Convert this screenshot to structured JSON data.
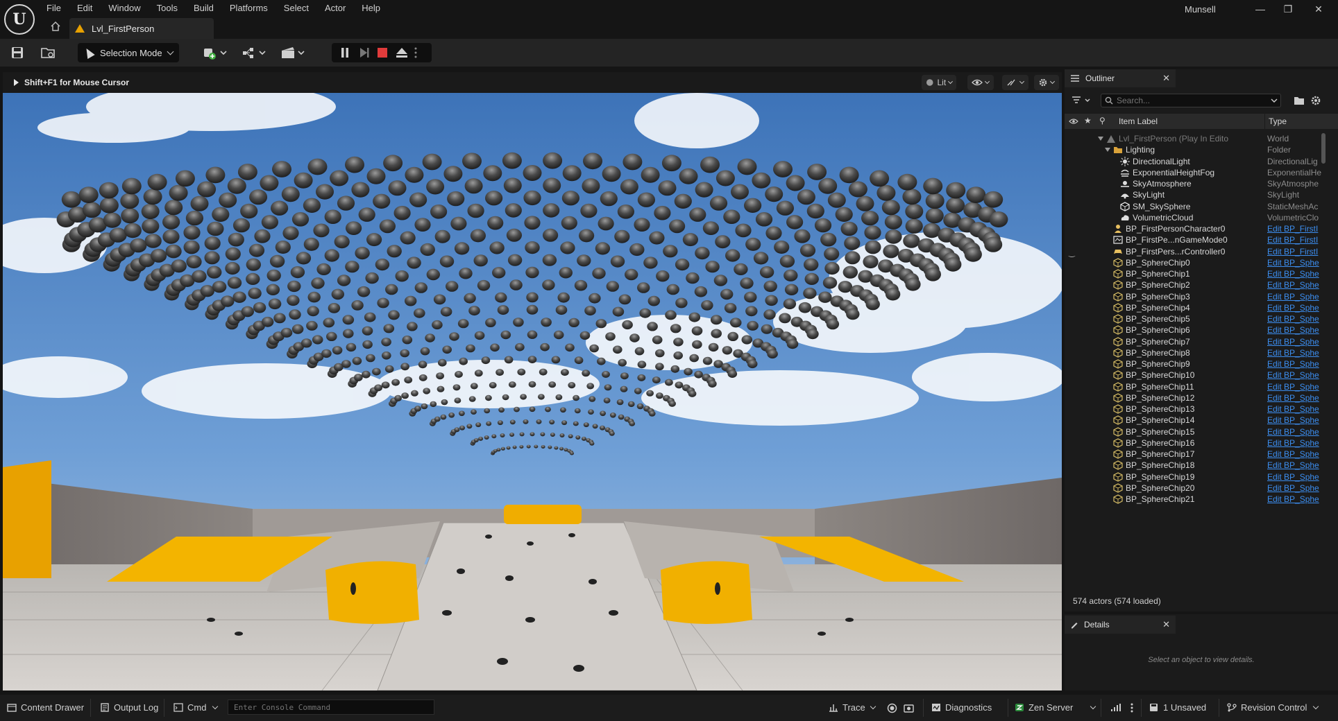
{
  "window": {
    "user": "Munsell",
    "controls": [
      "—",
      "❐",
      "✕"
    ]
  },
  "menu": [
    "File",
    "Edit",
    "Window",
    "Tools",
    "Build",
    "Platforms",
    "Select",
    "Actor",
    "Help"
  ],
  "level_tab": {
    "label": "Lvl_FirstPerson"
  },
  "toolbar": {
    "mode": "Selection Mode"
  },
  "viewport": {
    "hint": "Shift+F1 for Mouse Cursor",
    "view_mode": "Lit"
  },
  "outliner": {
    "tab": "Outliner",
    "search_placeholder": "Search...",
    "columns": {
      "label": "Item Label",
      "type": "Type"
    },
    "rows": [
      {
        "label": "Lvl_FirstPerson (Play In Edito",
        "type": "World",
        "icon": "level-icon",
        "link": false
      },
      {
        "label": "Lighting",
        "type": "Folder",
        "icon": "folder-icon",
        "link": false
      },
      {
        "label": "DirectionalLight",
        "type": "DirectionalLig",
        "icon": "sun-icon",
        "link": false
      },
      {
        "label": "ExponentialHeightFog",
        "type": "ExponentialHe",
        "icon": "fog-icon",
        "link": false
      },
      {
        "label": "SkyAtmosphere",
        "type": "SkyAtmosphe",
        "icon": "atmosphere-icon",
        "link": false
      },
      {
        "label": "SkyLight",
        "type": "SkyLight",
        "icon": "skylight-icon",
        "link": false
      },
      {
        "label": "SM_SkySphere",
        "type": "StaticMeshAc",
        "icon": "mesh-icon",
        "link": false
      },
      {
        "label": "VolumetricCloud",
        "type": "VolumetricClo",
        "icon": "cloud-icon",
        "link": false
      },
      {
        "label": "BP_FirstPersonCharacter0",
        "type": "Edit BP_FirstI",
        "icon": "character-icon",
        "link": true
      },
      {
        "label": "BP_FirstPe...nGameMode0",
        "type": "Edit BP_FirstI",
        "icon": "gamemode-icon",
        "link": true
      },
      {
        "label": "BP_FirstPers...rController0",
        "type": "Edit BP_FirstI",
        "icon": "controller-icon",
        "link": true
      },
      {
        "label": "BP_SphereChip0",
        "type": "Edit BP_Sphe",
        "icon": "blueprint-icon",
        "link": true
      },
      {
        "label": "BP_SphereChip1",
        "type": "Edit BP_Sphe",
        "icon": "blueprint-icon",
        "link": true
      },
      {
        "label": "BP_SphereChip2",
        "type": "Edit BP_Sphe",
        "icon": "blueprint-icon",
        "link": true
      },
      {
        "label": "BP_SphereChip3",
        "type": "Edit BP_Sphe",
        "icon": "blueprint-icon",
        "link": true
      },
      {
        "label": "BP_SphereChip4",
        "type": "Edit BP_Sphe",
        "icon": "blueprint-icon",
        "link": true
      },
      {
        "label": "BP_SphereChip5",
        "type": "Edit BP_Sphe",
        "icon": "blueprint-icon",
        "link": true
      },
      {
        "label": "BP_SphereChip6",
        "type": "Edit BP_Sphe",
        "icon": "blueprint-icon",
        "link": true
      },
      {
        "label": "BP_SphereChip7",
        "type": "Edit BP_Sphe",
        "icon": "blueprint-icon",
        "link": true
      },
      {
        "label": "BP_SphereChip8",
        "type": "Edit BP_Sphe",
        "icon": "blueprint-icon",
        "link": true
      },
      {
        "label": "BP_SphereChip9",
        "type": "Edit BP_Sphe",
        "icon": "blueprint-icon",
        "link": true
      },
      {
        "label": "BP_SphereChip10",
        "type": "Edit BP_Sphe",
        "icon": "blueprint-icon",
        "link": true
      },
      {
        "label": "BP_SphereChip11",
        "type": "Edit BP_Sphe",
        "icon": "blueprint-icon",
        "link": true
      },
      {
        "label": "BP_SphereChip12",
        "type": "Edit BP_Sphe",
        "icon": "blueprint-icon",
        "link": true
      },
      {
        "label": "BP_SphereChip13",
        "type": "Edit BP_Sphe",
        "icon": "blueprint-icon",
        "link": true
      },
      {
        "label": "BP_SphereChip14",
        "type": "Edit BP_Sphe",
        "icon": "blueprint-icon",
        "link": true
      },
      {
        "label": "BP_SphereChip15",
        "type": "Edit BP_Sphe",
        "icon": "blueprint-icon",
        "link": true
      },
      {
        "label": "BP_SphereChip16",
        "type": "Edit BP_Sphe",
        "icon": "blueprint-icon",
        "link": true
      },
      {
        "label": "BP_SphereChip17",
        "type": "Edit BP_Sphe",
        "icon": "blueprint-icon",
        "link": true
      },
      {
        "label": "BP_SphereChip18",
        "type": "Edit BP_Sphe",
        "icon": "blueprint-icon",
        "link": true
      },
      {
        "label": "BP_SphereChip19",
        "type": "Edit BP_Sphe",
        "icon": "blueprint-icon",
        "link": true
      },
      {
        "label": "BP_SphereChip20",
        "type": "Edit BP_Sphe",
        "icon": "blueprint-icon",
        "link": true
      },
      {
        "label": "BP_SphereChip21",
        "type": "Edit BP_Sphe",
        "icon": "blueprint-icon",
        "link": true
      }
    ],
    "actor_count": "574 actors (574 loaded)"
  },
  "details": {
    "tab": "Details",
    "empty_text": "Select an object to view details."
  },
  "statusbar": {
    "content_drawer": "Content Drawer",
    "output_log": "Output Log",
    "cmd": "Cmd",
    "console_placeholder": "Enter Console Command",
    "trace": "Trace",
    "diagnostics": "Diagnostics",
    "zen_server": "Zen Server",
    "unsaved": "1 Unsaved",
    "revision_control": "Revision Control"
  },
  "colors": {
    "accent_orange": "#e8a100",
    "link_blue": "#3c8ef0",
    "stop_red": "#e03b3b",
    "blueprint_icon": "#c8b060"
  }
}
